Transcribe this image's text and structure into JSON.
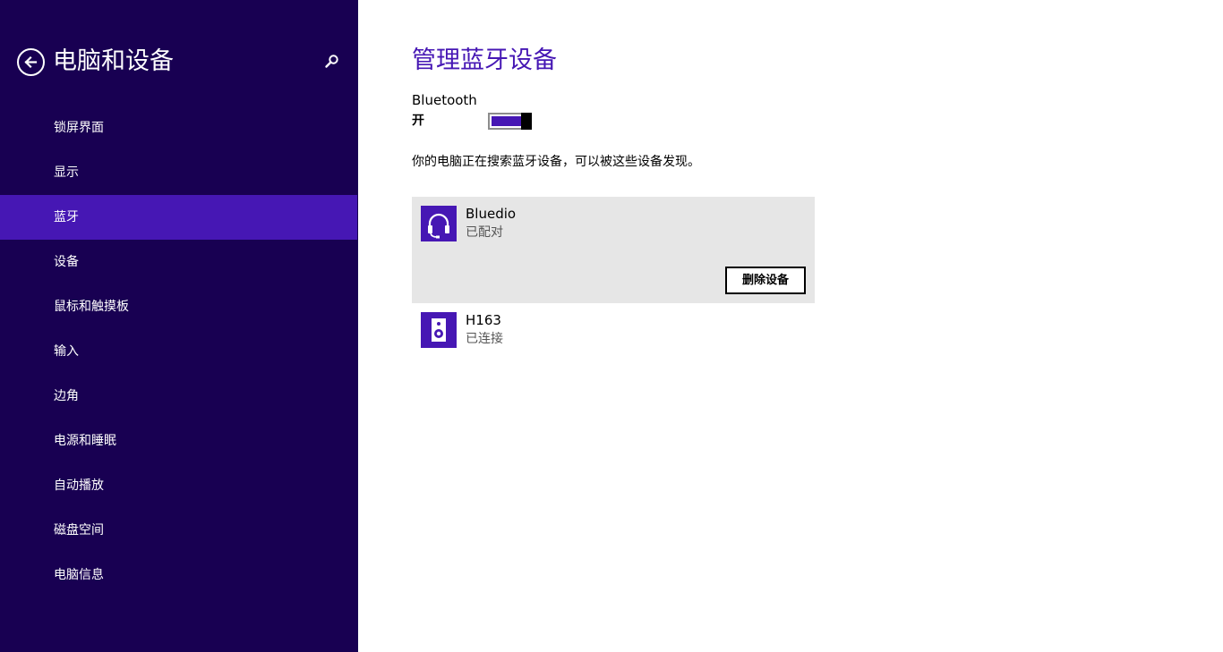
{
  "sidebar": {
    "title": "电脑和设备",
    "back_icon": "back-arrow-icon",
    "search_icon": "search-icon",
    "items": [
      {
        "label": "锁屏界面"
      },
      {
        "label": "显示"
      },
      {
        "label": "蓝牙",
        "active": true
      },
      {
        "label": "设备"
      },
      {
        "label": "鼠标和触摸板"
      },
      {
        "label": "输入"
      },
      {
        "label": "边角"
      },
      {
        "label": "电源和睡眠"
      },
      {
        "label": "自动播放"
      },
      {
        "label": "磁盘空间"
      },
      {
        "label": "电脑信息"
      }
    ]
  },
  "main": {
    "title": "管理蓝牙设备",
    "bluetooth_label": "Bluetooth",
    "bluetooth_state": "开",
    "bluetooth_on": true,
    "status_message": "你的电脑正在搜索蓝牙设备，可以被这些设备发现。",
    "devices": [
      {
        "name": "Bluedio",
        "status": "已配对",
        "icon": "headset-icon",
        "selected": true,
        "action_label": "删除设备"
      },
      {
        "name": "H163",
        "status": "已连接",
        "icon": "speaker-icon",
        "selected": false
      }
    ]
  },
  "colors": {
    "sidebar_bg": "#180052",
    "accent": "#4617b4",
    "selected_bg": "#e6e6e6"
  }
}
